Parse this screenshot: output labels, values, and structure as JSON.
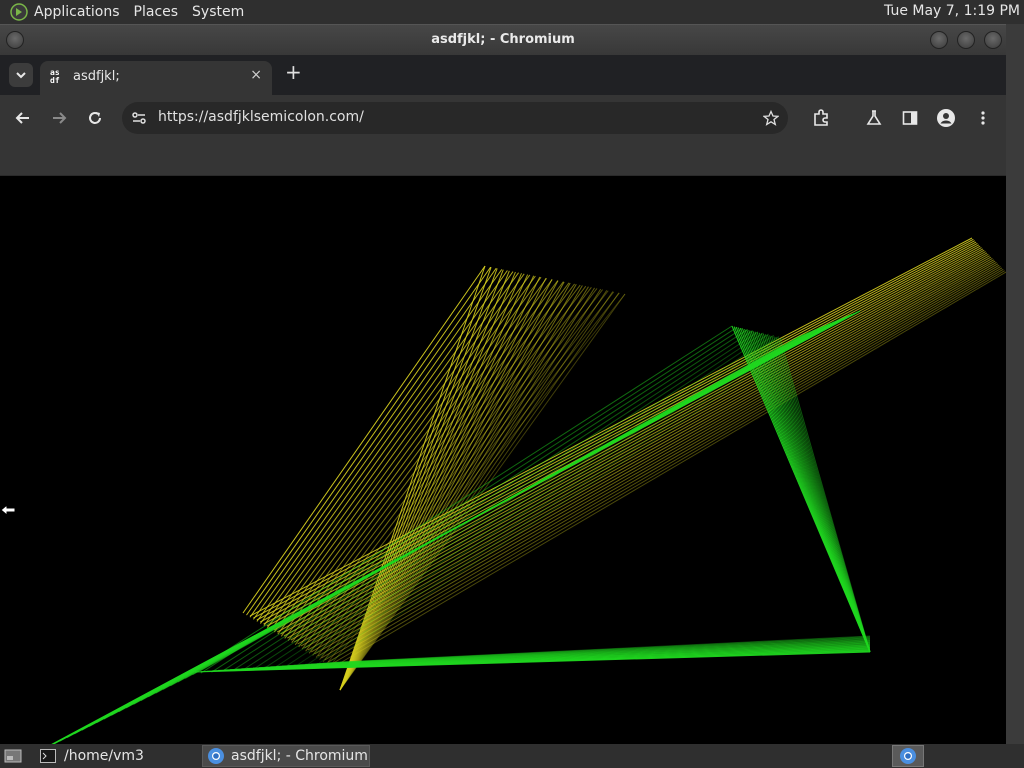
{
  "top_panel": {
    "menus": [
      "Applications",
      "Places",
      "System"
    ],
    "clock": "Tue May 7, 1:19 PM"
  },
  "window": {
    "title": "asdfjkl; - Chromium"
  },
  "browser": {
    "tab": {
      "title": "asdfjkl;",
      "favicon_text": [
        "as",
        "df"
      ],
      "close_label": "×"
    },
    "new_tab_label": "+",
    "url": "https://asdfjklsemicolon.com/",
    "toolbar_icons": [
      "back-icon",
      "forward-icon",
      "reload-icon",
      "site-settings-icon",
      "bookmark-star-icon",
      "extensions-icon",
      "labs-flask-icon",
      "side-panel-icon",
      "profile-icon",
      "menu-icon"
    ]
  },
  "content": {
    "description": "",
    "colors": {
      "yellow": "#d8d020",
      "green": "#20d820",
      "background": "#000000"
    }
  },
  "taskbar": {
    "items": [
      {
        "label": "/home/vm3",
        "icon": "terminal-icon"
      },
      {
        "label": "asdfjkl; - Chromium",
        "icon": "chromium-icon"
      }
    ]
  }
}
